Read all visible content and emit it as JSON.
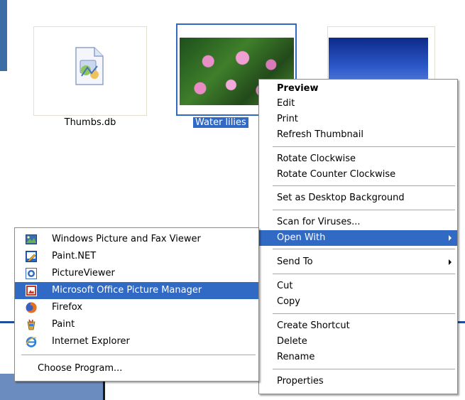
{
  "files": [
    {
      "name": "Thumbs.db"
    },
    {
      "name": "Water lilies",
      "selected": true
    },
    {
      "name": ""
    }
  ],
  "context_menu": {
    "items": [
      {
        "label": "Preview",
        "bold": true
      },
      {
        "label": "Edit"
      },
      {
        "label": "Print"
      },
      {
        "label": "Refresh Thumbnail"
      },
      {
        "label": "Rotate Clockwise"
      },
      {
        "label": "Rotate Counter Clockwise"
      },
      {
        "label": "Set as Desktop Background"
      },
      {
        "label": "Scan for Viruses..."
      },
      {
        "label": "Open With",
        "highlighted": true,
        "has_submenu": true
      },
      {
        "label": "Send To",
        "has_submenu": true
      },
      {
        "label": "Cut"
      },
      {
        "label": "Copy"
      },
      {
        "label": "Create Shortcut"
      },
      {
        "label": "Delete"
      },
      {
        "label": "Rename"
      },
      {
        "label": "Properties"
      }
    ]
  },
  "open_with_menu": {
    "items": [
      {
        "label": "Windows Picture and Fax Viewer",
        "icon": "picture-viewer-icon"
      },
      {
        "label": "Paint.NET",
        "icon": "paintdotnet-icon"
      },
      {
        "label": "PictureViewer",
        "icon": "pictureviewer-icon"
      },
      {
        "label": "Microsoft Office Picture Manager",
        "icon": "office-picture-manager-icon",
        "highlighted": true
      },
      {
        "label": "Firefox",
        "icon": "firefox-icon"
      },
      {
        "label": "Paint",
        "icon": "paint-icon"
      },
      {
        "label": "Internet Explorer",
        "icon": "internet-explorer-icon"
      },
      {
        "label": "Choose Program..."
      }
    ]
  },
  "colors": {
    "highlight": "#316ac5",
    "highlight_text": "#ffffff",
    "menu_border": "#8a8a8a"
  }
}
